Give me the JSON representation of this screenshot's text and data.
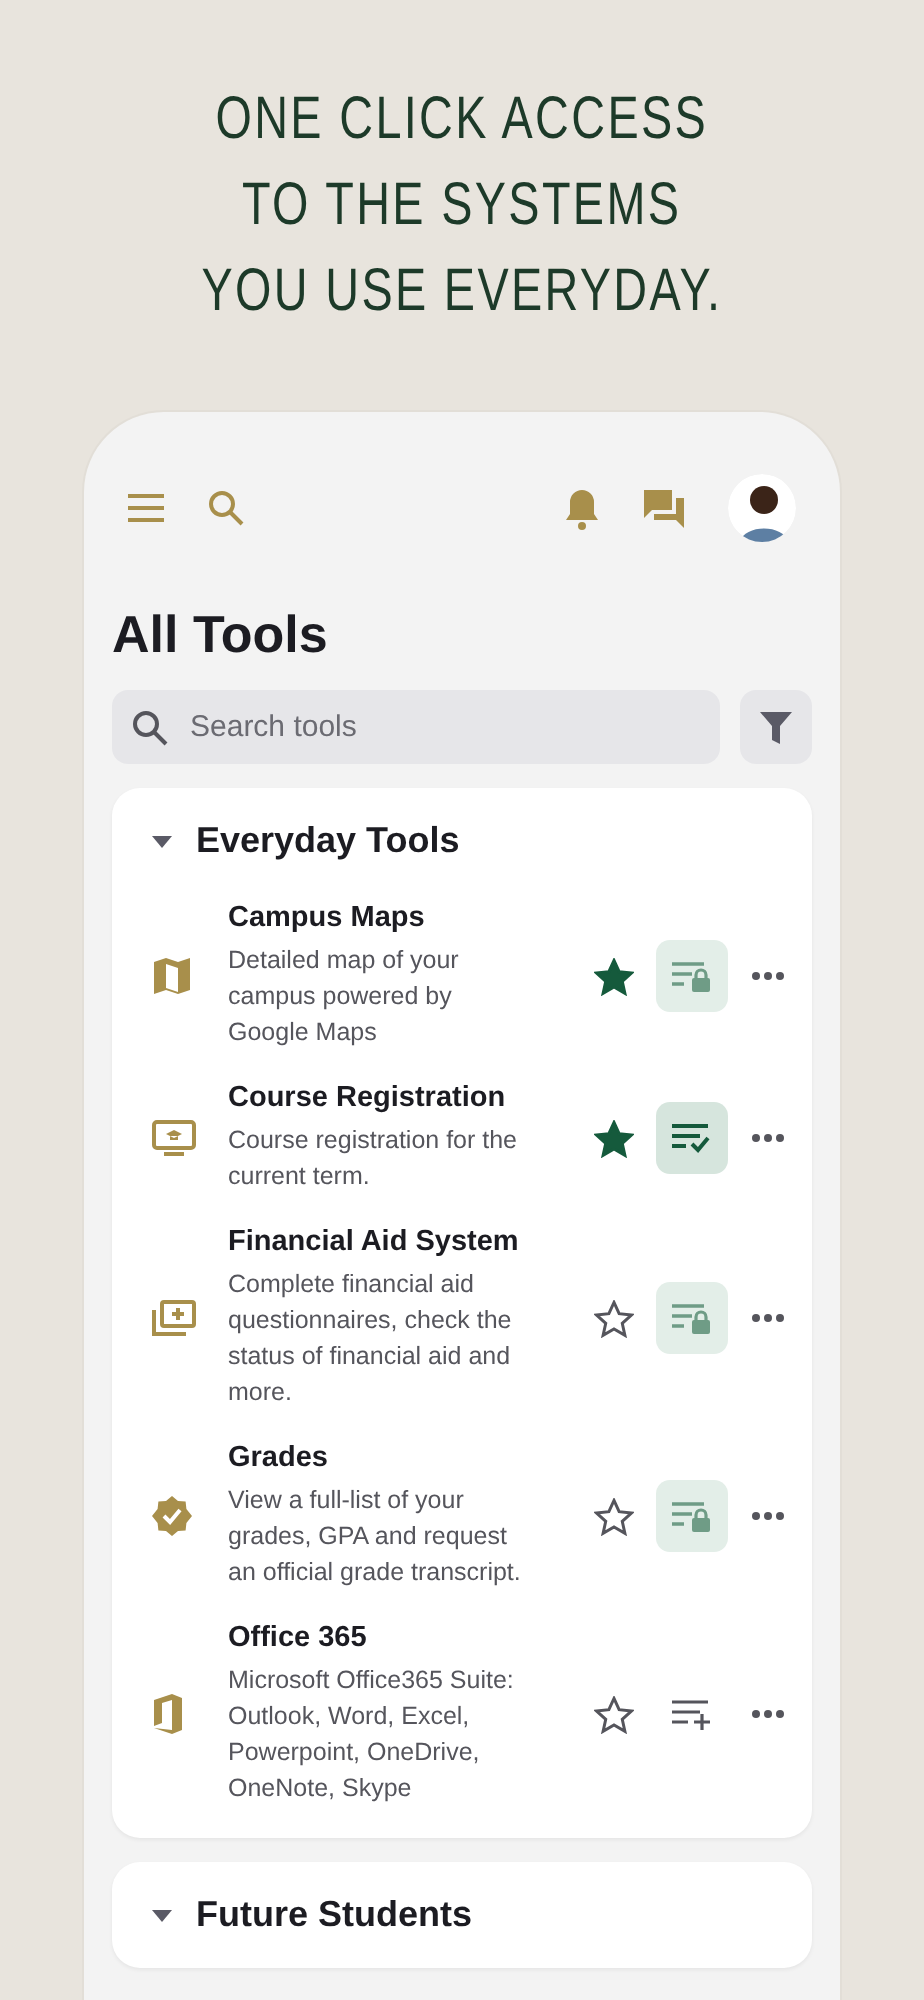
{
  "headline": [
    "ONE CLICK ACCESS",
    "TO THE SYSTEMS",
    "YOU USE EVERYDAY."
  ],
  "page_title": "All Tools",
  "search": {
    "placeholder": "Search tools"
  },
  "sections": [
    {
      "title": "Everyday Tools",
      "expanded": true,
      "tools": [
        {
          "name": "Campus Maps",
          "description": "Detailed map of your campus powered by Google Maps",
          "favorite": true,
          "kind": "locked"
        },
        {
          "name": "Course Registration",
          "description": "Course registration for the current term.",
          "favorite": true,
          "kind": "added"
        },
        {
          "name": "Financial Aid System",
          "description": "Complete financial aid questionnaires, check the status of financial aid and more.",
          "favorite": false,
          "kind": "locked"
        },
        {
          "name": "Grades",
          "description": "View a full-list of your grades, GPA and request an official grade transcript.",
          "favorite": false,
          "kind": "locked"
        },
        {
          "name": "Office 365",
          "description": "Microsoft Office365 Suite: Outlook, Word, Excel, Powerpoint, OneDrive, OneNote, Skype",
          "favorite": false,
          "kind": "add"
        }
      ]
    },
    {
      "title": "Future Students",
      "expanded": true
    }
  ]
}
